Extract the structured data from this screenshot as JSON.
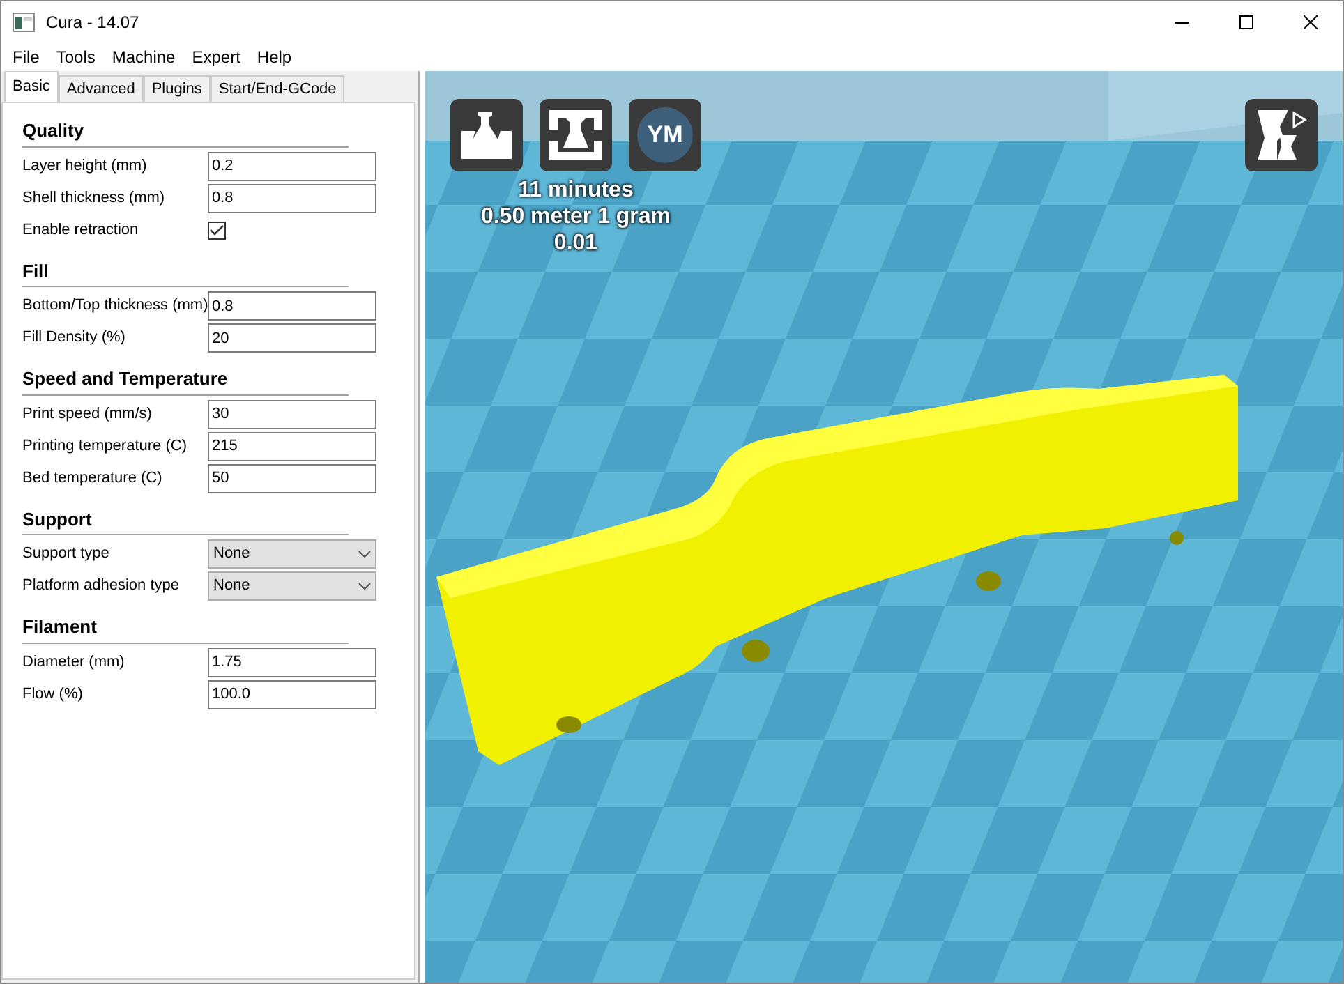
{
  "window": {
    "title": "Cura - 14.07"
  },
  "menu": [
    "File",
    "Tools",
    "Machine",
    "Expert",
    "Help"
  ],
  "tabs": [
    {
      "label": "Basic",
      "selected": true
    },
    {
      "label": "Advanced",
      "selected": false
    },
    {
      "label": "Plugins",
      "selected": false
    },
    {
      "label": "Start/End-GCode",
      "selected": false
    }
  ],
  "sections": [
    {
      "title": "Quality",
      "fields": [
        {
          "kind": "text",
          "label": "Layer height (mm)",
          "value": "0.2"
        },
        {
          "kind": "text",
          "label": "Shell thickness (mm)",
          "value": "0.8"
        },
        {
          "kind": "checkbox",
          "label": "Enable retraction",
          "checked": true
        }
      ]
    },
    {
      "title": "Fill",
      "fields": [
        {
          "kind": "text",
          "label": "Bottom/Top thickness (mm)",
          "value": "0.8"
        },
        {
          "kind": "text",
          "label": "Fill Density (%)",
          "value": "20"
        }
      ]
    },
    {
      "title": "Speed and Temperature",
      "fields": [
        {
          "kind": "text",
          "label": "Print speed (mm/s)",
          "value": "30"
        },
        {
          "kind": "text",
          "label": "Printing temperature (C)",
          "value": "215"
        },
        {
          "kind": "text",
          "label": "Bed temperature (C)",
          "value": "50"
        }
      ]
    },
    {
      "title": "Support",
      "fields": [
        {
          "kind": "select",
          "label": "Support type",
          "value": "None"
        },
        {
          "kind": "select",
          "label": "Platform adhesion type",
          "value": "None"
        }
      ]
    },
    {
      "title": "Filament",
      "fields": [
        {
          "kind": "text",
          "label": "Diameter (mm)",
          "value": "1.75"
        },
        {
          "kind": "text",
          "label": "Flow (%)",
          "value": "100.0"
        }
      ]
    }
  ],
  "viewport": {
    "toolbar": [
      {
        "kind": "load"
      },
      {
        "kind": "save"
      },
      {
        "kind": "badge",
        "label": "YM"
      }
    ],
    "print_info": [
      "11 minutes",
      "0.50 meter 1 gram",
      "0.01"
    ]
  }
}
